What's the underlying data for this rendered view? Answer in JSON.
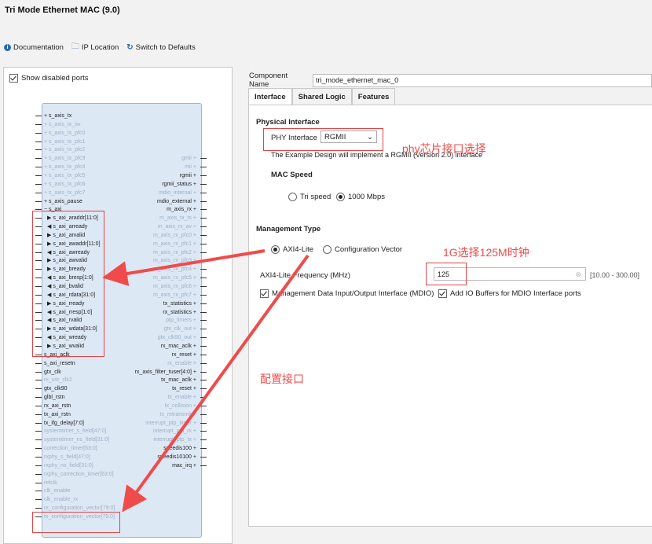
{
  "window": {
    "title": "Tri Mode Ethernet MAC (9.0)"
  },
  "toolbar": {
    "documentation": "Documentation",
    "ip_location": "IP Location",
    "switch_defaults": "Switch to Defaults"
  },
  "left": {
    "show_disabled_ports": "Show disabled ports",
    "ports_left": [
      {
        "label": "s_axis_tx",
        "disabled": false,
        "kind": "bus"
      },
      {
        "label": "s_axis_tx_av",
        "disabled": true,
        "kind": "bus"
      },
      {
        "label": "s_axis_tx_pfc0",
        "disabled": true,
        "kind": "bus"
      },
      {
        "label": "s_axis_tx_pfc1",
        "disabled": true,
        "kind": "bus"
      },
      {
        "label": "s_axis_tx_pfc2",
        "disabled": true,
        "kind": "bus"
      },
      {
        "label": "s_axis_tx_pfc3",
        "disabled": true,
        "kind": "bus"
      },
      {
        "label": "s_axis_tx_pfc4",
        "disabled": true,
        "kind": "bus"
      },
      {
        "label": "s_axis_tx_pfc5",
        "disabled": true,
        "kind": "bus"
      },
      {
        "label": "s_axis_tx_pfc6",
        "disabled": true,
        "kind": "bus"
      },
      {
        "label": "s_axis_tx_pfc7",
        "disabled": true,
        "kind": "bus"
      },
      {
        "label": "s_axis_pause",
        "disabled": false,
        "kind": "bus"
      },
      {
        "label": "s_axi",
        "disabled": false,
        "kind": "minus"
      },
      {
        "label": "s_axi_araddr[11:0]",
        "disabled": false,
        "kind": "in"
      },
      {
        "label": "s_axi_arready",
        "disabled": false,
        "kind": "out"
      },
      {
        "label": "s_axi_arvalid",
        "disabled": false,
        "kind": "in"
      },
      {
        "label": "s_axi_awaddr[11:0]",
        "disabled": false,
        "kind": "in"
      },
      {
        "label": "s_axi_awready",
        "disabled": false,
        "kind": "out"
      },
      {
        "label": "s_axi_awvalid",
        "disabled": false,
        "kind": "in"
      },
      {
        "label": "s_axi_bready",
        "disabled": false,
        "kind": "in"
      },
      {
        "label": "s_axi_bresp[1:0]",
        "disabled": false,
        "kind": "out"
      },
      {
        "label": "s_axi_bvalid",
        "disabled": false,
        "kind": "out"
      },
      {
        "label": "s_axi_rdata[31:0]",
        "disabled": false,
        "kind": "out"
      },
      {
        "label": "s_axi_rready",
        "disabled": false,
        "kind": "in"
      },
      {
        "label": "s_axi_rresp[1:0]",
        "disabled": false,
        "kind": "out"
      },
      {
        "label": "s_axi_rvalid",
        "disabled": false,
        "kind": "out"
      },
      {
        "label": "s_axi_wdata[31:0]",
        "disabled": false,
        "kind": "in"
      },
      {
        "label": "s_axi_wready",
        "disabled": false,
        "kind": "out"
      },
      {
        "label": "s_axi_wvalid",
        "disabled": false,
        "kind": "in"
      },
      {
        "label": "s_axi_aclk",
        "disabled": false,
        "kind": "wire"
      },
      {
        "label": "s_axi_resetn",
        "disabled": false,
        "kind": "wire"
      },
      {
        "label": "gtx_clk",
        "disabled": false,
        "kind": "wire"
      },
      {
        "label": "rx_usr_clk2",
        "disabled": true,
        "kind": "wire"
      },
      {
        "label": "gtx_clk90",
        "disabled": false,
        "kind": "wire"
      },
      {
        "label": "glbl_rstn",
        "disabled": false,
        "kind": "wire"
      },
      {
        "label": "rx_axi_rstn",
        "disabled": false,
        "kind": "wire"
      },
      {
        "label": "tx_axi_rstn",
        "disabled": false,
        "kind": "wire"
      },
      {
        "label": "tx_ifg_delay[7:0]",
        "disabled": false,
        "kind": "wire"
      },
      {
        "label": "systemtimer_s_field[47:0]",
        "disabled": true,
        "kind": "wire"
      },
      {
        "label": "systemtimer_ns_field[31:0]",
        "disabled": true,
        "kind": "wire"
      },
      {
        "label": "correction_timer[63:0]",
        "disabled": true,
        "kind": "wire"
      },
      {
        "label": "rxphy_s_field[47:0]",
        "disabled": true,
        "kind": "wire"
      },
      {
        "label": "rxphy_ns_field[31:0]",
        "disabled": true,
        "kind": "wire"
      },
      {
        "label": "rxphy_correction_timer[63:0]",
        "disabled": true,
        "kind": "wire"
      },
      {
        "label": "refclk",
        "disabled": true,
        "kind": "wire"
      },
      {
        "label": "clk_enable",
        "disabled": true,
        "kind": "wire"
      },
      {
        "label": "clk_enable_rx",
        "disabled": true,
        "kind": "wire"
      },
      {
        "label": "rx_configuration_vector[79:0]",
        "disabled": true,
        "kind": "wire"
      },
      {
        "label": "tx_configuration_vector[79:0]",
        "disabled": true,
        "kind": "wire"
      }
    ],
    "ports_right": [
      {
        "label": "gmii",
        "disabled": true,
        "row": 5
      },
      {
        "label": "mii",
        "disabled": true,
        "row": 6
      },
      {
        "label": "rgmii",
        "disabled": false,
        "row": 7
      },
      {
        "label": "rgmii_status",
        "disabled": false,
        "row": 8
      },
      {
        "label": "mdio_internal",
        "disabled": true,
        "row": 9
      },
      {
        "label": "mdio_external",
        "disabled": false,
        "row": 10
      },
      {
        "label": "m_axis_rx",
        "disabled": false,
        "row": 11
      },
      {
        "label": "m_axis_tx_ts",
        "disabled": true,
        "row": 12
      },
      {
        "label": "m_axis_rx_av",
        "disabled": true,
        "row": 13
      },
      {
        "label": "m_axis_rx_pfc0",
        "disabled": true,
        "row": 14
      },
      {
        "label": "m_axis_rx_pfc1",
        "disabled": true,
        "row": 15
      },
      {
        "label": "m_axis_rx_pfc2",
        "disabled": true,
        "row": 16
      },
      {
        "label": "m_axis_rx_pfc3",
        "disabled": true,
        "row": 17
      },
      {
        "label": "m_axis_rx_pfc4",
        "disabled": true,
        "row": 18
      },
      {
        "label": "m_axis_rx_pfc5",
        "disabled": true,
        "row": 19
      },
      {
        "label": "m_axis_rx_pfc6",
        "disabled": true,
        "row": 20
      },
      {
        "label": "m_axis_rx_pfc7",
        "disabled": true,
        "row": 21
      },
      {
        "label": "tx_statistics",
        "disabled": false,
        "row": 22
      },
      {
        "label": "rx_statistics",
        "disabled": false,
        "row": 23
      },
      {
        "label": "ptp_timers",
        "disabled": true,
        "row": 24
      },
      {
        "label": "gtx_clk_out",
        "disabled": true,
        "row": 25
      },
      {
        "label": "gtx_clk90_out",
        "disabled": true,
        "row": 26
      },
      {
        "label": "rx_mac_aclk",
        "disabled": false,
        "row": 27
      },
      {
        "label": "rx_reset",
        "disabled": false,
        "row": 28
      },
      {
        "label": "rx_enable",
        "disabled": true,
        "row": 29
      },
      {
        "label": "rx_axis_filter_tuser[4:0]",
        "disabled": false,
        "row": 30
      },
      {
        "label": "tx_mac_aclk",
        "disabled": false,
        "row": 31
      },
      {
        "label": "tx_reset",
        "disabled": false,
        "row": 32
      },
      {
        "label": "tx_enable",
        "disabled": true,
        "row": 33
      },
      {
        "label": "tx_collision",
        "disabled": true,
        "row": 34
      },
      {
        "label": "tx_retransmit",
        "disabled": true,
        "row": 35
      },
      {
        "label": "interrupt_ptp_timer",
        "disabled": true,
        "row": 36
      },
      {
        "label": "interrupt_ptp_rx",
        "disabled": true,
        "row": 37
      },
      {
        "label": "interrupt_ptp_tx",
        "disabled": true,
        "row": 38
      },
      {
        "label": "speedis100",
        "disabled": false,
        "row": 39
      },
      {
        "label": "speedis10100",
        "disabled": false,
        "row": 40
      },
      {
        "label": "mac_irq",
        "disabled": false,
        "row": 41
      }
    ]
  },
  "right": {
    "component_name_label": "Component Name",
    "component_name_value": "tri_mode_ethernet_mac_0",
    "tabs": [
      "Interface",
      "Shared Logic",
      "Features"
    ],
    "physical_interface": {
      "heading": "Physical Interface",
      "phy_label": "PHY Interface",
      "phy_value": "RGMII",
      "example_text": "The Example Design will implement a RGMII (Version 2.0) interface"
    },
    "mac_speed": {
      "heading": "MAC Speed",
      "tri_speed": "Tri speed",
      "mbps1000": "1000 Mbps"
    },
    "management": {
      "heading": "Management Type",
      "axi4_lite": "AXI4-Lite",
      "config_vector": "Configuration Vector",
      "freq_label": "AXI4-Lite Frequency (MHz)",
      "freq_value": "125",
      "freq_range": "[10.00 - 300.00]",
      "mdio_label": "Management Data Input/Output Interface (MDIO)",
      "io_buffers_label": "Add IO Buffers for MDIO Interface ports"
    }
  },
  "annotations": {
    "phy_select": "phy芯片接口选择",
    "freq_note": "1G选择125M时钟",
    "config_interface": "配置接口"
  },
  "colors": {
    "annotation_red": "#ef4b4b",
    "block_fill": "#dde8f5"
  }
}
